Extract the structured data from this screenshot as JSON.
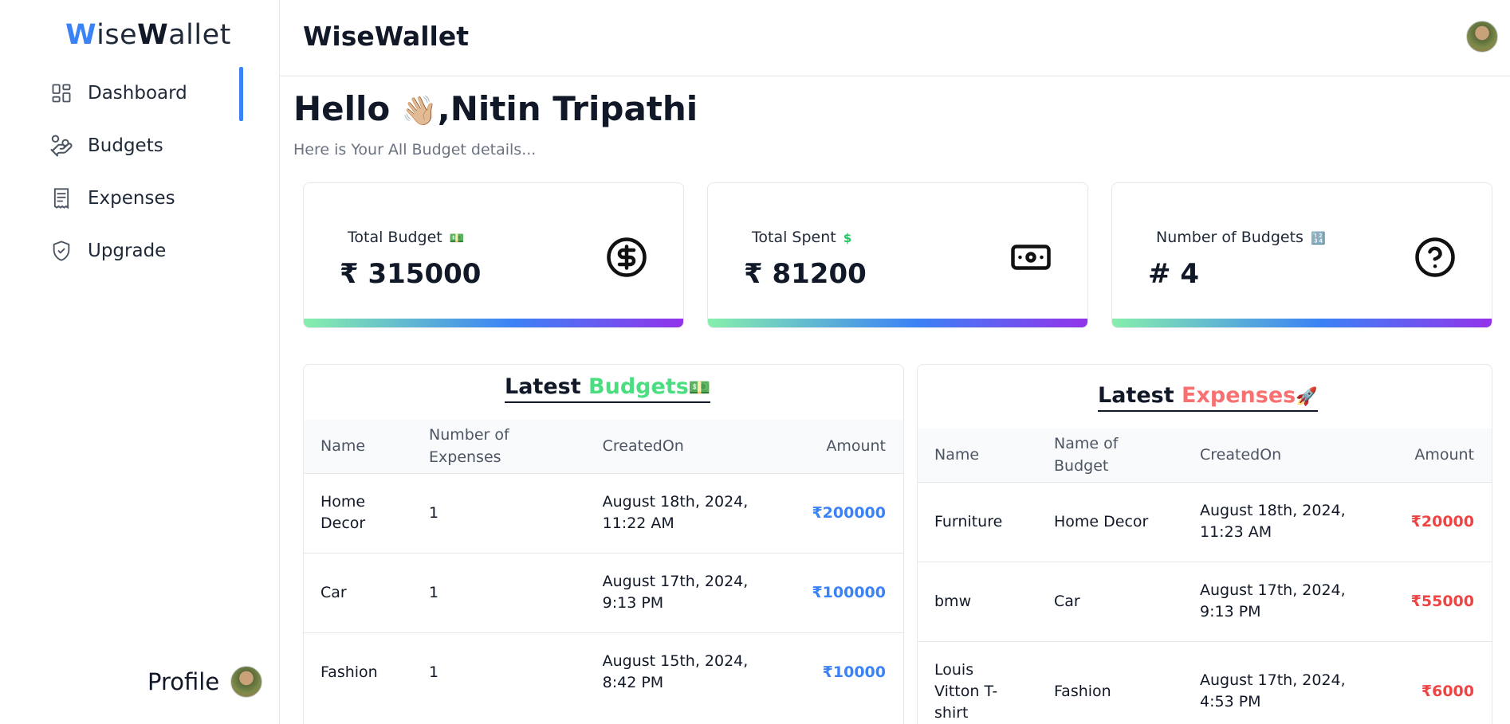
{
  "sidebar": {
    "logo": {
      "w1": "W",
      "rest1": "ise",
      "w2": "W",
      "rest2": "allet"
    },
    "items": [
      {
        "label": "Dashboard",
        "icon": "dashboard-icon",
        "active": true
      },
      {
        "label": "Budgets",
        "icon": "budgets-icon"
      },
      {
        "label": "Expenses",
        "icon": "receipt-icon"
      },
      {
        "label": "Upgrade",
        "icon": "shield-check-icon"
      }
    ],
    "profile_label": "Profile"
  },
  "header": {
    "title": "WiseWallet"
  },
  "greeting": {
    "hello": "Hello",
    "wave": "👋🏼",
    "name": ",Nitin Tripathi",
    "subtitle": "Here is Your All Budget details..."
  },
  "cards": [
    {
      "label": "Total Budget",
      "emoji": "💵",
      "value": "₹ 315000",
      "icon": "dollar-circle-icon"
    },
    {
      "label": "Total Spent",
      "emoji": "$",
      "value": "₹ 81200",
      "icon": "banknote-icon"
    },
    {
      "label": "Number of Budgets",
      "emoji": "🔢",
      "value": "# 4",
      "icon": "question-circle-icon"
    }
  ],
  "latest_budgets": {
    "title_a": "Latest ",
    "title_b": "Budgets",
    "title_emoji": "💵",
    "headers": [
      "Name",
      "Number of Expenses",
      "CreatedOn",
      "Amount"
    ],
    "rows": [
      {
        "name": "Home Decor",
        "count": "1",
        "created": "August 18th, 2024, 11:22 AM",
        "amount": "₹200000"
      },
      {
        "name": "Car",
        "count": "1",
        "created": "August 17th, 2024, 9:13 PM",
        "amount": "₹100000"
      },
      {
        "name": "Fashion",
        "count": "1",
        "created": "August 15th, 2024, 8:42 PM",
        "amount": "₹10000"
      }
    ]
  },
  "latest_expenses": {
    "title_a": "Latest ",
    "title_b": "Expenses",
    "title_emoji": "🚀",
    "headers": [
      "Name",
      "Name of Budget",
      "CreatedOn",
      "Amount"
    ],
    "rows": [
      {
        "name": "Furniture",
        "budget": "Home Decor",
        "created": "August 18th, 2024, 11:23 AM",
        "amount": "₹20000"
      },
      {
        "name": "bmw",
        "budget": "Car",
        "created": "August 17th, 2024, 9:13 PM",
        "amount": "₹55000"
      },
      {
        "name": "Louis Vitton T-shirt",
        "budget": "Fashion",
        "created": "August 17th, 2024, 4:53 PM",
        "amount": "₹6000"
      }
    ]
  },
  "colors": {
    "accent": "#3b82f6",
    "green": "#4ade80",
    "red": "#ef4444"
  }
}
